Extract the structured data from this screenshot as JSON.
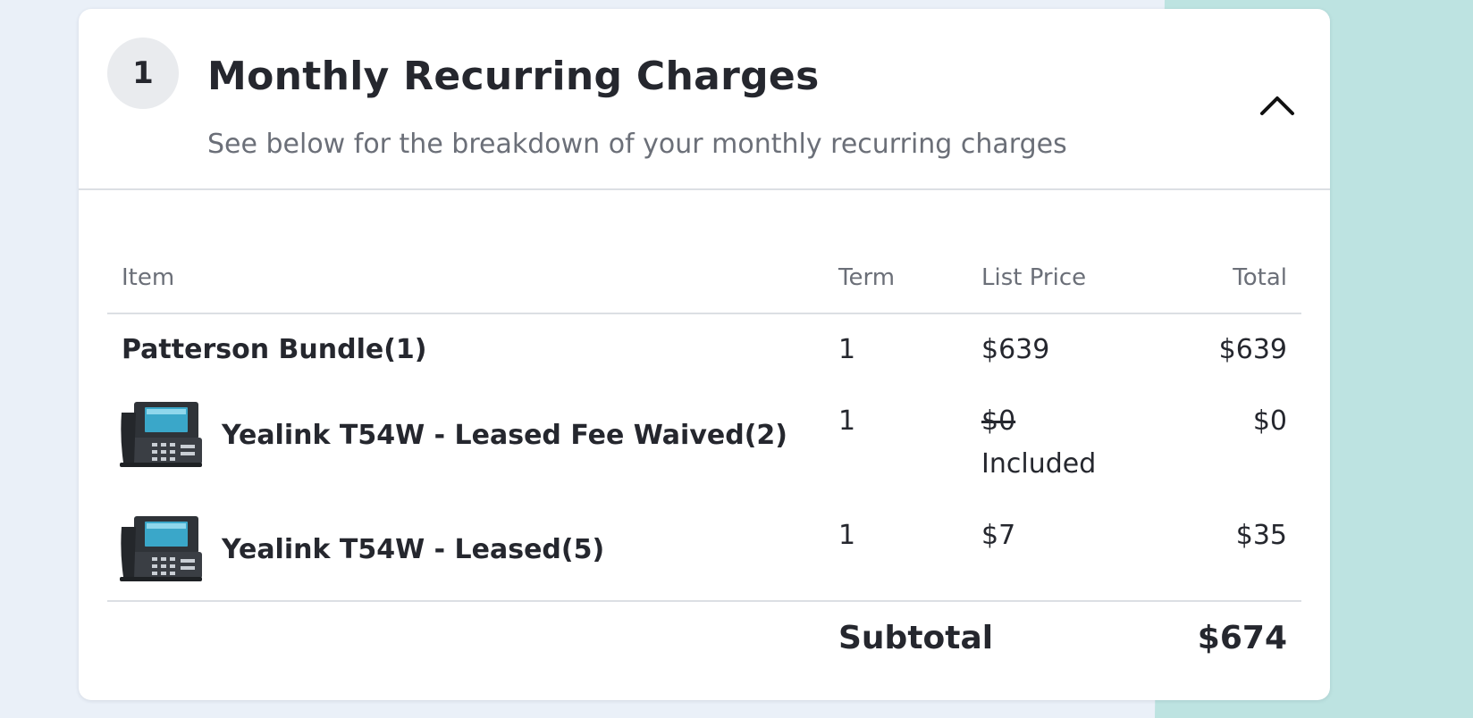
{
  "section": {
    "step_number": "1",
    "title": "Monthly Recurring Charges",
    "subtitle": "See below for the breakdown of your monthly recurring charges"
  },
  "table": {
    "columns": [
      "Item",
      "Term",
      "List Price",
      "Total"
    ],
    "rows": [
      {
        "item": "Patterson Bundle(1)",
        "term": "1",
        "list_price": "$639",
        "total": "$639"
      },
      {
        "item": "Yealink T54W - Leased Fee Waived(2)",
        "term": "1",
        "list_price": "$0",
        "list_price_note": "Included",
        "total": "$0",
        "icon": "desk-phone-icon"
      },
      {
        "item": "Yealink T54W - Leased(5)",
        "term": "1",
        "list_price": "$7",
        "total": "$35",
        "icon": "desk-phone-icon"
      }
    ],
    "subtotal_label": "Subtotal",
    "subtotal_value": "$674"
  },
  "colors": {
    "accent_teal": "#bde3e1",
    "page_background": "#eaf0f8",
    "text_primary": "#25272e",
    "text_muted": "#6b6f78"
  }
}
